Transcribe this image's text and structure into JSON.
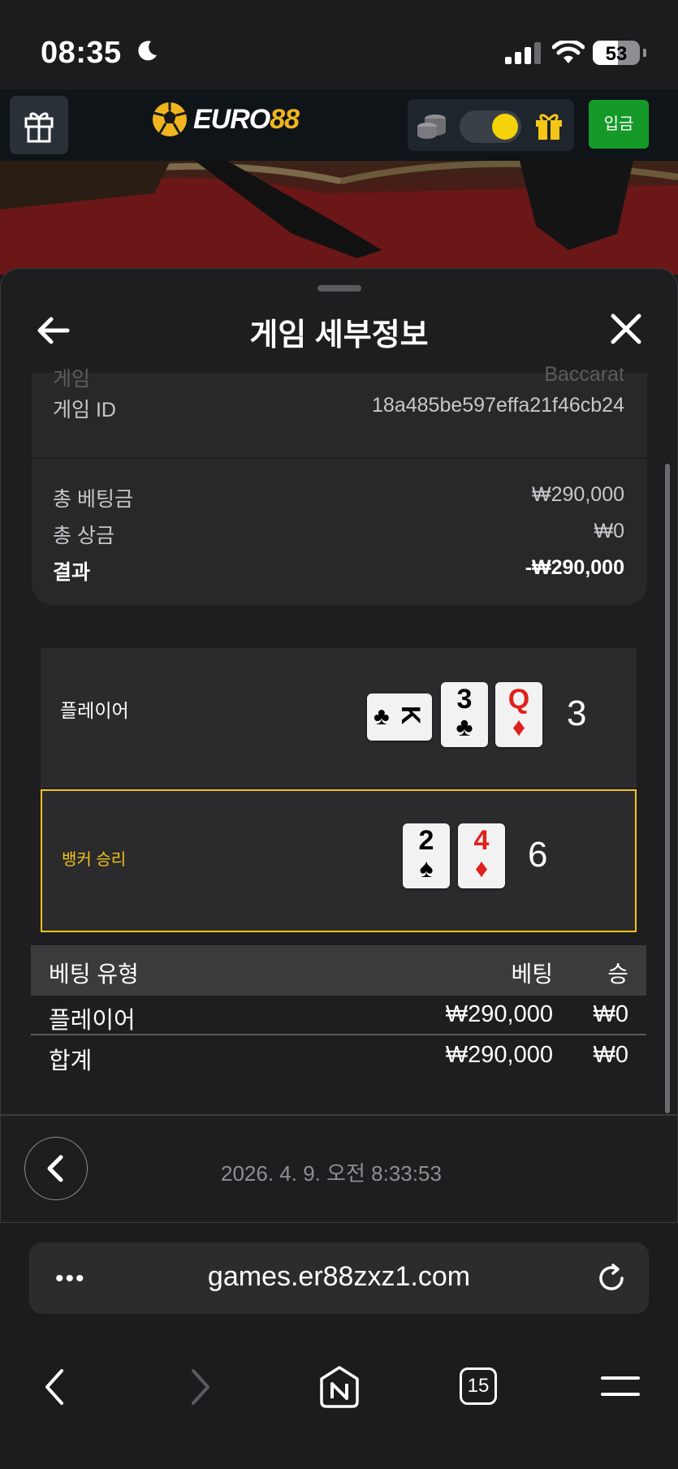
{
  "status": {
    "time": "08:35",
    "battery": "53",
    "battery_level": 0.53
  },
  "header": {
    "logo_prefix": "EURO",
    "logo_suffix": "88",
    "deposit_label": "입금"
  },
  "sheet": {
    "title": "게임 세부정보",
    "game_label": "게임",
    "game_value": "Baccarat",
    "game_id_label": "게임 ID",
    "game_id_value": "18a485be597effa21f46cb24",
    "total_bet_label": "총 베팅금",
    "total_bet_value": "₩290,000",
    "total_prize_label": "총 상금",
    "total_prize_value": "₩0",
    "result_label": "결과",
    "result_value": "-₩290,000"
  },
  "hands": {
    "player": {
      "label": "플레이어",
      "score": "3",
      "cards": [
        {
          "rank": "K",
          "suit": "♣",
          "color": "#000000",
          "rotated": true
        },
        {
          "rank": "3",
          "suit": "♣",
          "color": "#000000"
        },
        {
          "rank": "Q",
          "suit": "♦",
          "color": "#e0201c"
        }
      ]
    },
    "banker": {
      "label": "뱅커 승리",
      "score": "6",
      "cards": [
        {
          "rank": "2",
          "suit": "♠",
          "color": "#000000"
        },
        {
          "rank": "4",
          "suit": "♦",
          "color": "#e0201c"
        }
      ]
    }
  },
  "bets": {
    "headers": [
      "베팅 유형",
      "베팅",
      "승"
    ],
    "rows": [
      {
        "type": "플레이어",
        "bet": "₩290,000",
        "win": "₩0"
      }
    ],
    "total": {
      "type": "합계",
      "bet": "₩290,000",
      "win": "₩0"
    }
  },
  "footer": {
    "date": "2026. 4. 9. 오전 8:33:53"
  },
  "browser": {
    "url": "games.er88zxz1.com",
    "tabs_count": "15"
  },
  "colors": {
    "accent_yellow": "#f0c419",
    "deposit_green": "#159a2a",
    "logo_gold": "#f0b51e"
  }
}
